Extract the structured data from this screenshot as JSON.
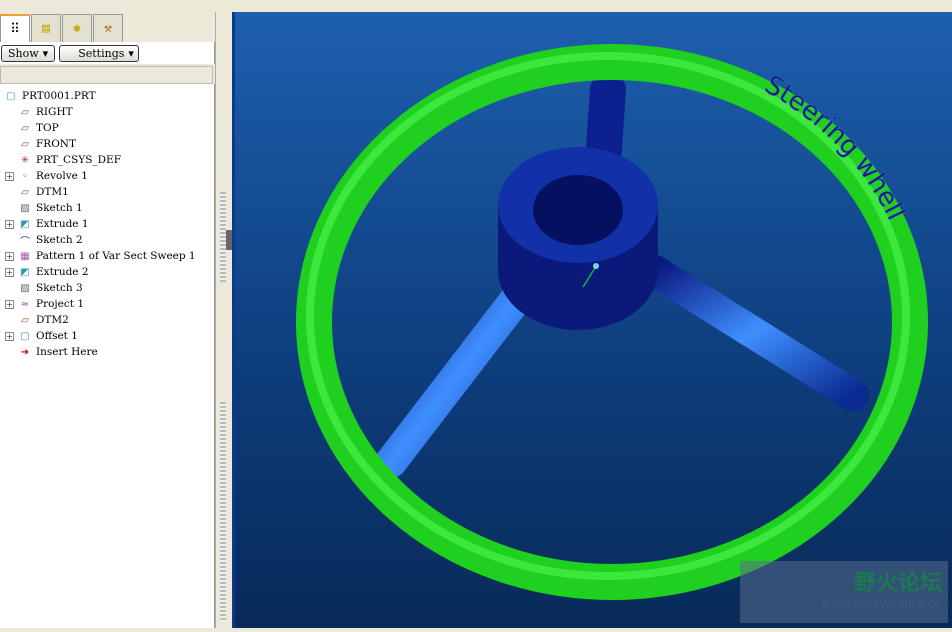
{
  "panel": {
    "show_label": "Show",
    "settings_label": "Settings"
  },
  "tree": [
    {
      "label": "PRT0001.PRT",
      "icon": "part-icon",
      "expand": false,
      "root": true
    },
    {
      "label": "RIGHT",
      "icon": "datum-plane-icon",
      "expand": false
    },
    {
      "label": "TOP",
      "icon": "datum-plane-icon",
      "expand": false
    },
    {
      "label": "FRONT",
      "icon": "datum-plane-icon",
      "expand": false
    },
    {
      "label": "PRT_CSYS_DEF",
      "icon": "csys-icon",
      "expand": false
    },
    {
      "label": "Revolve 1",
      "icon": "revolve-icon",
      "expand": true
    },
    {
      "label": "DTM1",
      "icon": "datum-plane-icon",
      "expand": false
    },
    {
      "label": "Sketch 1",
      "icon": "sketch-icon",
      "expand": false
    },
    {
      "label": "Extrude 1",
      "icon": "extrude-icon",
      "expand": true
    },
    {
      "label": "Sketch 2",
      "icon": "sketch-curve-icon",
      "expand": false
    },
    {
      "label": "Pattern 1 of Var Sect Sweep 1",
      "icon": "pattern-icon",
      "expand": true
    },
    {
      "label": "Extrude 2",
      "icon": "extrude-icon",
      "expand": true
    },
    {
      "label": "Sketch 3",
      "icon": "sketch-icon",
      "expand": false
    },
    {
      "label": "Project 1",
      "icon": "project-icon",
      "expand": true
    },
    {
      "label": "DTM2",
      "icon": "datum-plane-icon",
      "expand": false
    },
    {
      "label": "Offset 1",
      "icon": "offset-icon",
      "expand": true
    },
    {
      "label": "Insert Here",
      "icon": "insert-arrow-icon",
      "expand": false
    }
  ],
  "model": {
    "text": "Steering whell",
    "wheel_color": "#22dd22",
    "hub_color": "#0a1a80"
  },
  "watermark": {
    "cn": "野火论坛",
    "url": "www.proewildfire.cn"
  }
}
